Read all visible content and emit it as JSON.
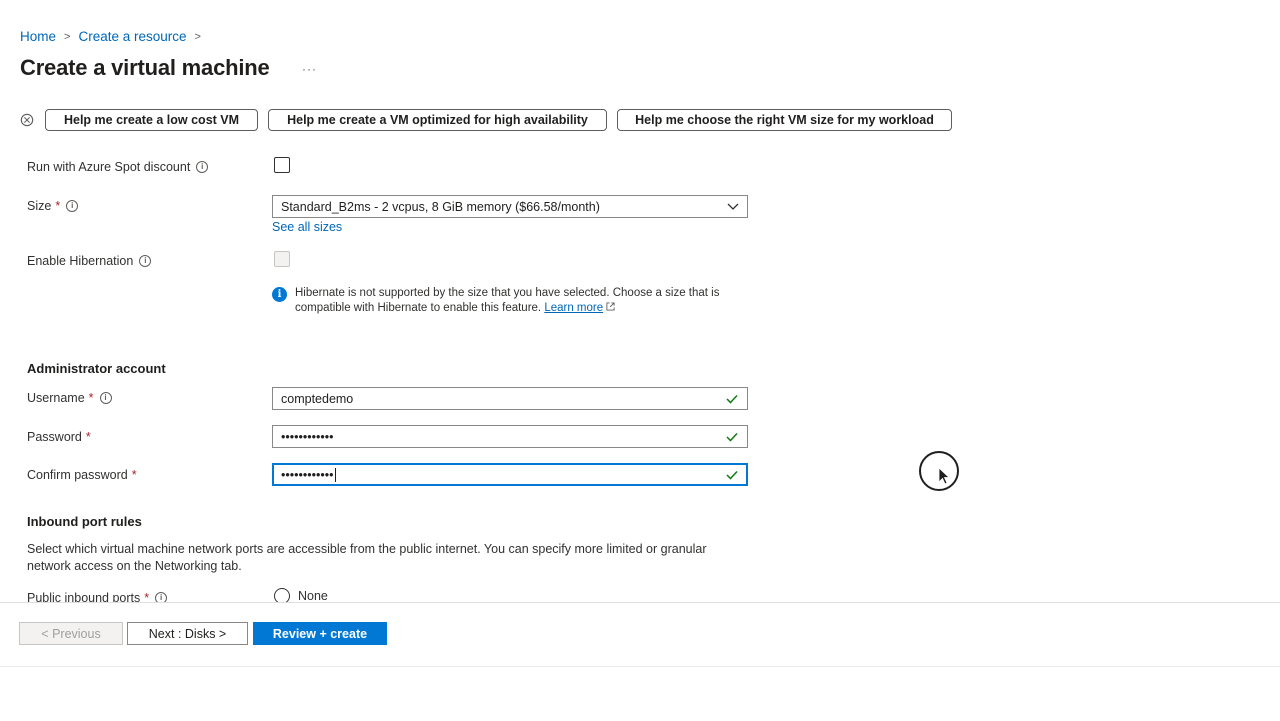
{
  "breadcrumb": {
    "home": "Home",
    "create_resource": "Create a resource",
    "sep": ">"
  },
  "page": {
    "title": "Create a virtual machine",
    "more": "···"
  },
  "copilot_buttons": {
    "low_cost": "Help me create a low cost VM",
    "high_availability": "Help me create a VM optimized for high availability",
    "right_size": "Help me choose the right VM size for my workload"
  },
  "spot": {
    "label": "Run with Azure Spot discount",
    "checked": false
  },
  "size": {
    "label": "Size",
    "required": "*",
    "value": "Standard_B2ms - 2 vcpus, 8 GiB memory ($66.58/month)",
    "see_all": "See all sizes"
  },
  "hibernation": {
    "label": "Enable Hibernation",
    "info_text": "Hibernate is not supported by the size that you have selected. Choose a size that is compatible with Hibernate to enable this feature.",
    "learn_more": "Learn more"
  },
  "admin": {
    "section_title": "Administrator account",
    "username_label": "Username",
    "username_value": "comptedemo",
    "password_label": "Password",
    "password_value": "••••••••••••",
    "confirm_label": "Confirm password",
    "confirm_value": "••••••••••••",
    "required": "*"
  },
  "inbound": {
    "section_title": "Inbound port rules",
    "description": "Select which virtual machine network ports are accessible from the public internet. You can specify more limited or granular network access on the Networking tab.",
    "public_ports_label": "Public inbound ports",
    "option_none": "None"
  },
  "footer": {
    "previous": "< Previous",
    "next": "Next : Disks >",
    "review": "Review + create"
  },
  "colors": {
    "accent": "#0078d4",
    "link": "#0067b8",
    "success": "#107c10",
    "required": "#a4262c"
  },
  "icons": [
    "copilot-icon",
    "info-icon",
    "chevron-down-icon",
    "check-icon",
    "external-link-icon",
    "cursor-icon"
  ]
}
